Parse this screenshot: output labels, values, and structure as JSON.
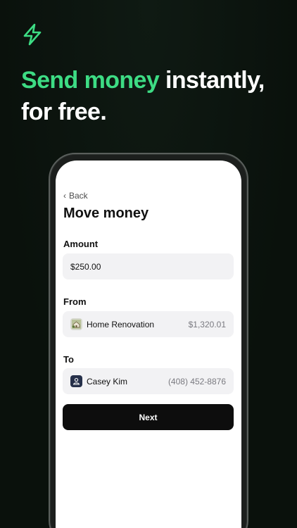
{
  "headline": {
    "accent": "Send money",
    "rest": " instantly, for free."
  },
  "screen": {
    "back_label": "Back",
    "title": "Move money",
    "amount": {
      "label": "Amount",
      "value": "$250.00"
    },
    "from": {
      "label": "From",
      "account_name": "Home Renovation",
      "balance": "$1,320.01",
      "icon": "house-icon"
    },
    "to": {
      "label": "To",
      "contact_name": "Casey Kim",
      "phone": "(408) 452-8876",
      "icon": "person-icon"
    },
    "next_label": "Next"
  },
  "colors": {
    "accent": "#3ddc84",
    "background": "#0b130e",
    "button": "#0d0d0d"
  }
}
